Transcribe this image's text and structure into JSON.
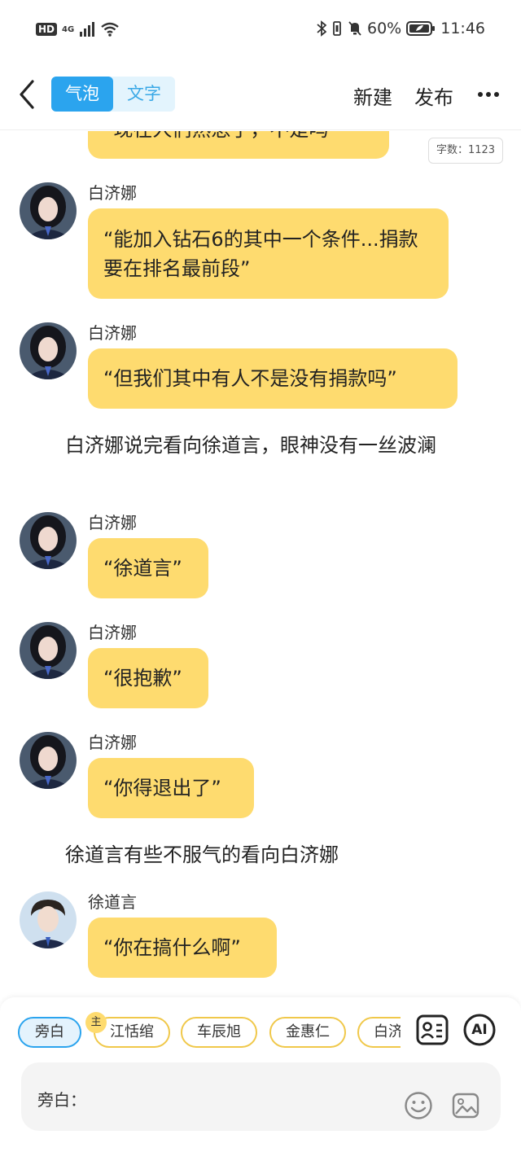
{
  "status_bar": {
    "hd": "HD",
    "network": "4G",
    "battery_percent": "60%",
    "time": "11:46"
  },
  "header": {
    "mode_bubble": "气泡",
    "mode_text": "文字",
    "new_label": "新建",
    "publish_label": "发布"
  },
  "chat": {
    "word_count": "字数：1123",
    "top_bubble_partial": "“现在人们熟悉了，不是吗”",
    "messages": [
      {
        "speaker": "白济娜",
        "text": "“能加入钻石6的其中一个条件...捐款要在排名最前段”"
      },
      {
        "speaker": "白济娜",
        "text": "“但我们其中有人不是没有捐款吗”"
      },
      {
        "speaker": "白济娜",
        "text": "“徐道言”"
      },
      {
        "speaker": "白济娜",
        "text": "“很抱歉”"
      },
      {
        "speaker": "白济娜",
        "text": "“你得退出了”"
      },
      {
        "speaker": "徐道言",
        "text": "“你在搞什么啊”"
      }
    ],
    "narrations": [
      "白济娜说完看向徐道言，眼神没有一丝波澜",
      "徐道言有些不服气的看向白济娜"
    ]
  },
  "bottom": {
    "chips": [
      "旁白",
      "江恬绾",
      "车辰旭",
      "金惠仁",
      "白济娜"
    ],
    "host_badge": "主",
    "ai_label": "AI",
    "input_label": "旁白：",
    "input_value": ""
  }
}
